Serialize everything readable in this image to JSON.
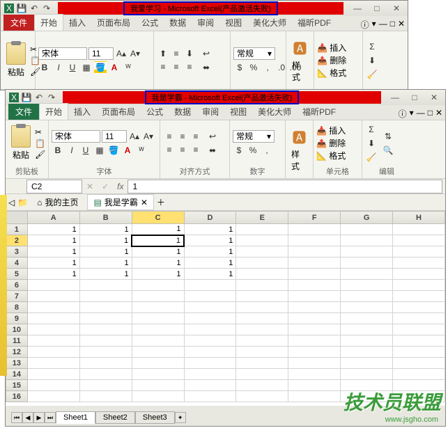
{
  "window1": {
    "title": "我爱学习 - Microsoft Excel(产品激活失败)",
    "tabs": {
      "file": "文件",
      "home": "开始",
      "insert": "插入",
      "layout": "页面布局",
      "formula": "公式",
      "data": "数据",
      "review": "审阅",
      "view": "视图",
      "beauty": "美化大师",
      "pdf": "福昕PDF"
    },
    "font": {
      "name": "宋体",
      "size": "11"
    },
    "number_format": "常规",
    "paste": "粘贴",
    "styles": "样式",
    "cells": {
      "insert": "插入",
      "delete": "删除",
      "format": "格式"
    }
  },
  "window2": {
    "title": "我是学霸 - Microsoft Excel(产品激活失败)",
    "tabs": {
      "file": "文件",
      "home": "开始",
      "insert": "插入",
      "layout": "页面布局",
      "formula": "公式",
      "data": "数据",
      "review": "审阅",
      "view": "视图",
      "beauty": "美化大师",
      "pdf": "福昕PDF"
    },
    "font": {
      "name": "宋体",
      "size": "11"
    },
    "number_format": "常规",
    "paste": "粘贴",
    "styles": "样式",
    "cells": {
      "insert": "插入",
      "delete": "删除",
      "format": "格式"
    },
    "groups": {
      "clipboard": "剪贴板",
      "font": "字体",
      "align": "对齐方式",
      "number": "数字",
      "cells": "单元格",
      "edit": "编辑"
    },
    "namebox": "C2",
    "formula": "1",
    "doctabs": {
      "home": "我的主页",
      "doc": "我是学霸"
    },
    "cols": [
      "A",
      "B",
      "C",
      "D",
      "E",
      "F",
      "G",
      "H"
    ],
    "rows": [
      "1",
      "2",
      "3",
      "4",
      "5",
      "6",
      "7",
      "8",
      "9",
      "10",
      "11",
      "12",
      "13",
      "14",
      "15",
      "16"
    ],
    "data": [
      [
        "1",
        "1",
        "1",
        "1",
        "",
        "",
        "",
        ""
      ],
      [
        "1",
        "1",
        "1",
        "1",
        "",
        "",
        "",
        ""
      ],
      [
        "1",
        "1",
        "1",
        "1",
        "",
        "",
        "",
        ""
      ],
      [
        "1",
        "1",
        "1",
        "1",
        "",
        "",
        "",
        ""
      ],
      [
        "1",
        "1",
        "1",
        "1",
        "",
        "",
        "",
        ""
      ]
    ],
    "sheets": [
      "Sheet1",
      "Sheet2",
      "Sheet3"
    ]
  },
  "watermark": {
    "text": "技术员联盟",
    "url": "www.jsgho.com"
  }
}
